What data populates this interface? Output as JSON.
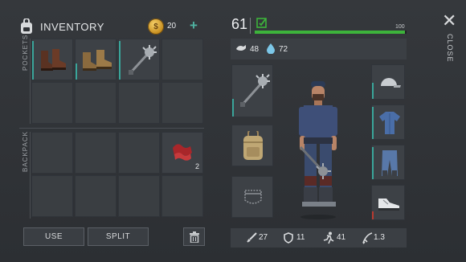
{
  "inventory": {
    "title": "INVENTORY",
    "coins": "20",
    "plus_label": "+",
    "pockets_label": "POCKETS",
    "backpack_label": "BACKPACK"
  },
  "pockets": [
    {
      "item": "boots",
      "icon": "brown-boots-icon"
    },
    {
      "item": "boots",
      "icon": "tan-boots-icon"
    },
    {
      "item": "mace",
      "icon": "spiked-mace-icon"
    },
    {
      "item": "",
      "icon": ""
    },
    {
      "item": "",
      "icon": ""
    },
    {
      "item": "",
      "icon": ""
    },
    {
      "item": "",
      "icon": ""
    },
    {
      "item": "",
      "icon": ""
    }
  ],
  "backpack": [
    {
      "item": "",
      "icon": ""
    },
    {
      "item": "",
      "icon": ""
    },
    {
      "item": "",
      "icon": ""
    },
    {
      "item": "red cloth",
      "icon": "red-cloth-icon",
      "quantity": "2"
    },
    {
      "item": "",
      "icon": ""
    },
    {
      "item": "",
      "icon": ""
    },
    {
      "item": "",
      "icon": ""
    },
    {
      "item": "",
      "icon": ""
    }
  ],
  "buttons": {
    "use": "USE",
    "split": "SPLIT"
  },
  "player": {
    "level": "61",
    "xp_max": "100",
    "xp_progress": 0.99,
    "food": "48",
    "water": "72"
  },
  "stats": {
    "attack": "27",
    "armor": "11",
    "speed": "41",
    "multiplier": "1.3"
  },
  "close_label": "CLOSE",
  "colors": {
    "xp_bar": "#3db33b",
    "accent": "#3aa59a",
    "coin": "#d9a52c"
  }
}
